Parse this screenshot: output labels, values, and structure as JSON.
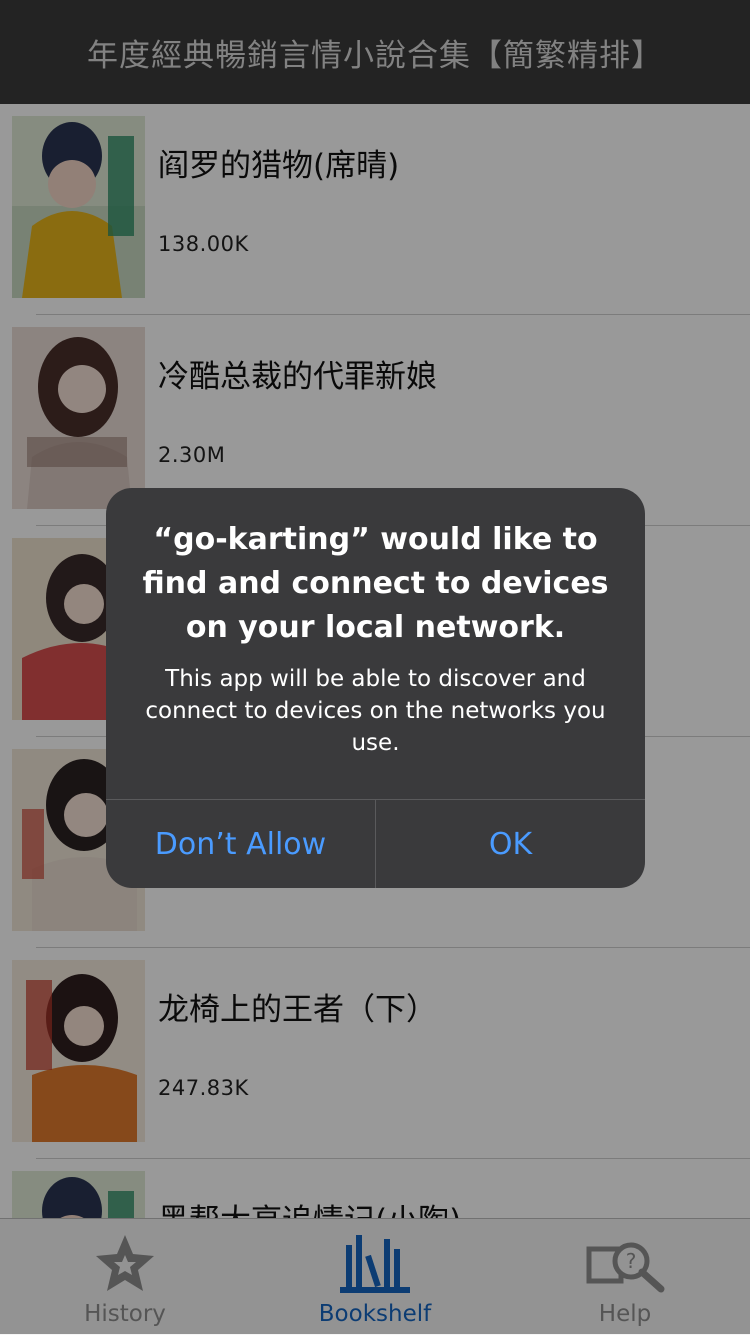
{
  "navbar": {
    "title": "年度經典暢銷言情小說合集【簡繁精排】"
  },
  "books": [
    {
      "title": "阎罗的猎物(席晴)",
      "size": "138.00K"
    },
    {
      "title": "冷酷总裁的代罪新娘",
      "size": "2.30M"
    },
    {
      "title": "",
      "size": ""
    },
    {
      "title": "",
      "size": ""
    },
    {
      "title": "龙椅上的王者（下）",
      "size": "247.83K"
    },
    {
      "title": "黑帮大亨追情记(小陶)",
      "size": ""
    }
  ],
  "tabs": [
    {
      "label": "History",
      "icon": "star-icon"
    },
    {
      "label": "Bookshelf",
      "icon": "bookshelf-icon"
    },
    {
      "label": "Help",
      "icon": "help-search-icon"
    }
  ],
  "alert": {
    "title": "“go-karting” would like to find and connect to devices on your local network.",
    "message": "This app will be able to discover and connect to devices on the networks you use.",
    "deny_label": "Don’t Allow",
    "ok_label": "OK"
  },
  "colors": {
    "navbar": "#3b3b3b",
    "tab_active": "#1565c0",
    "alert_button": "#4a9bff"
  }
}
